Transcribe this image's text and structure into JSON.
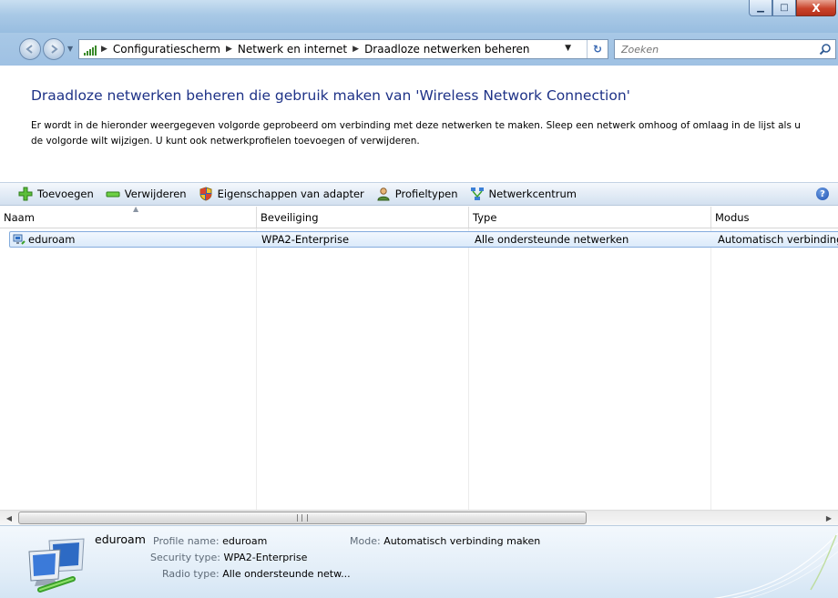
{
  "window": {
    "caption": {
      "minimize": "▁",
      "maximize": "□",
      "close": "X"
    }
  },
  "address": {
    "icon": "network-signal-icon",
    "crumbs": [
      "Configuratiescherm",
      "Netwerk en internet",
      "Draadloze netwerken beheren"
    ],
    "search_placeholder": "Zoeken"
  },
  "header": {
    "title": "Draadloze netwerken beheren die gebruik maken van 'Wireless Network Connection'",
    "description": "Er wordt in de hieronder weergegeven volgorde geprobeerd om verbinding met deze netwerken te maken. Sleep een netwerk omhoog of omlaag in de lijst als u de volgorde wilt wijzigen. U kunt ook netwerkprofielen toevoegen of verwijderen."
  },
  "toolbar": {
    "items": [
      {
        "label": "Toevoegen",
        "icon": "add-icon"
      },
      {
        "label": "Verwijderen",
        "icon": "remove-icon"
      },
      {
        "label": "Eigenschappen van adapter",
        "icon": "shield-icon"
      },
      {
        "label": "Profieltypen",
        "icon": "user-icon"
      },
      {
        "label": "Netwerkcentrum",
        "icon": "network-center-icon"
      }
    ],
    "help": "?"
  },
  "list": {
    "columns": [
      "Naam",
      "Beveiliging",
      "Type",
      "Modus"
    ],
    "rows": [
      {
        "name": "eduroam",
        "security": "WPA2-Enterprise",
        "type": "Alle ondersteunde netwerken",
        "mode": "Automatisch verbinding maken"
      }
    ]
  },
  "scrollbar": {
    "left": "◀",
    "right": "▶"
  },
  "details": {
    "name": "eduroam",
    "profile_label": "Profile name:",
    "profile_value": "eduroam",
    "mode_label": "Mode:",
    "mode_value": "Automatisch verbinding maken",
    "security_label": "Security type:",
    "security_value": "WPA2-Enterprise",
    "radio_label": "Radio type:",
    "radio_value": "Alle ondersteunde netw..."
  }
}
